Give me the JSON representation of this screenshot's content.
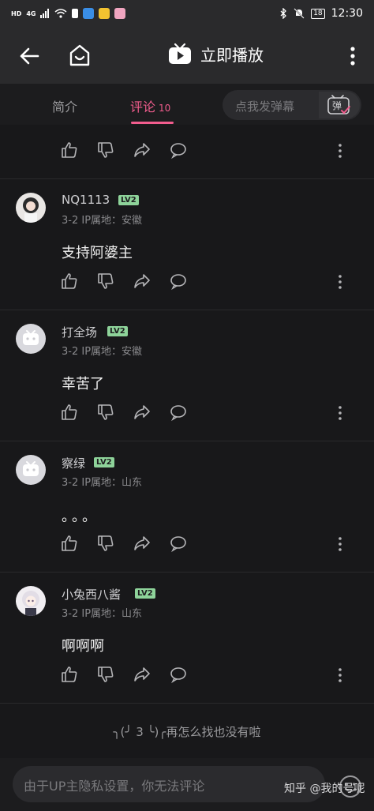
{
  "status_bar": {
    "hd": "HD",
    "network": "4G",
    "time": "12:30",
    "battery": "18"
  },
  "nav": {
    "title": "立即播放"
  },
  "tabs": {
    "intro": "简介",
    "comments": "评论",
    "comments_count": "10",
    "danmaku_placeholder": "点我发弹幕",
    "danmaku_button": "弹"
  },
  "comments": [
    {
      "name": "NQ1113",
      "level": "LV2",
      "meta": "3-2 IP属地：安徽",
      "text": "支持阿婆主"
    },
    {
      "name": "打全场",
      "level": "LV2",
      "meta": "3-2 IP属地：安徽",
      "text": "幸苦了"
    },
    {
      "name": "察绿",
      "level": "LV2",
      "meta": "3-2 IP属地：山东",
      "text": "。。。"
    },
    {
      "name": "小兔西八酱",
      "level": "LV2",
      "meta": "3-2 IP属地：山东",
      "text": "啊啊啊"
    }
  ],
  "end_text": "╮(╯ 3 ╰)╭再怎么找也没有啦",
  "bottom": {
    "input_placeholder": "由于UP主隐私设置，你无法评论",
    "watermark": "知乎 @我的号呢"
  },
  "colors": {
    "accent": "#f25d8e",
    "level_badge": "#8ed39a",
    "background": "#18181a"
  }
}
